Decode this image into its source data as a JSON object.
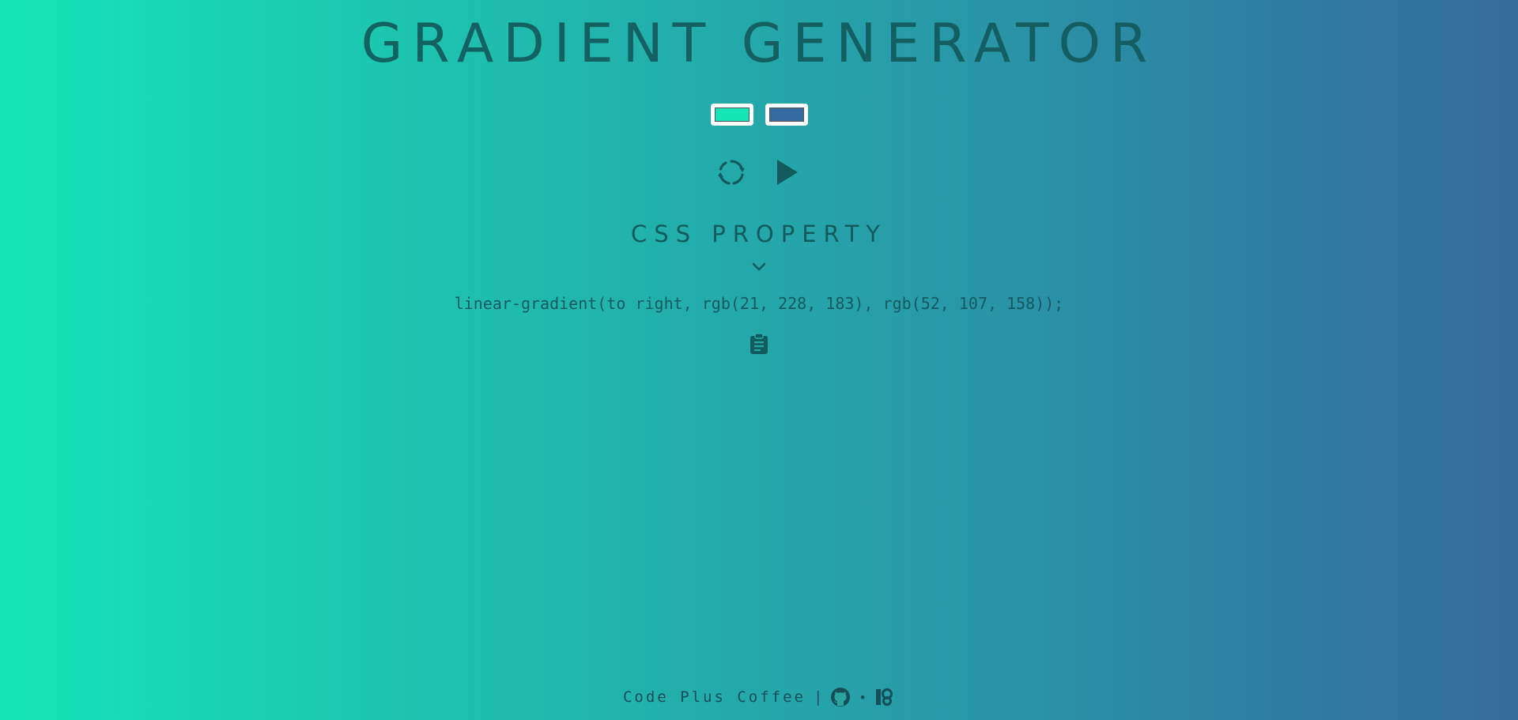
{
  "header": {
    "title": "GRADIENT GENERATOR"
  },
  "color_pickers": [
    {
      "name": "color-one",
      "value": "#15e4b7"
    },
    {
      "name": "color-two",
      "value": "#346b9e"
    }
  ],
  "controls": {
    "refresh_icon": "refresh-icon",
    "play_icon": "play-icon"
  },
  "css_section": {
    "title": "CSS PROPERTY",
    "toggle_icon": "chevron-down-icon",
    "code": "linear-gradient(to right, rgb(21, 228, 183), rgb(52, 107, 158));",
    "copy_icon": "clipboard-icon"
  },
  "footer": {
    "brand": "Code Plus Coffee",
    "separator": "|",
    "dot": "•",
    "github_icon": "github-icon",
    "patreon_icon": "patreon-icon"
  },
  "colors": {
    "gradient_start": "#15e4b7",
    "gradient_end": "#346b9e",
    "text": "#135a5c"
  }
}
